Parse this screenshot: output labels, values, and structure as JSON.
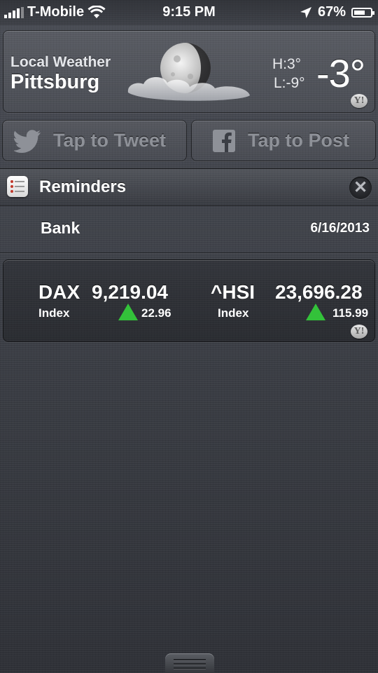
{
  "status_bar": {
    "carrier": "T-Mobile",
    "time": "9:15 PM",
    "battery_percent_label": "67%",
    "battery_level": 0.67,
    "icons": [
      "signal-bars-icon",
      "wifi-icon",
      "location-arrow-icon",
      "battery-icon"
    ]
  },
  "weather": {
    "label": "Local Weather",
    "city": "Pittsburg",
    "high": "H:3°",
    "low": "L:-9°",
    "temperature": "-3°",
    "condition_icon": "moon-cloud-icon",
    "provider_badge": "Y!"
  },
  "share": {
    "tweet_label": "Tap to Tweet",
    "post_label": "Tap to Post",
    "tweet_icon": "twitter-bird-icon",
    "post_icon": "facebook-f-icon"
  },
  "reminders": {
    "title": "Reminders",
    "items": [
      {
        "name": "Bank",
        "date": "6/16/2013"
      }
    ]
  },
  "stocks": {
    "items": [
      {
        "symbol": "DAX",
        "price": "9,219.04",
        "kind": "Index",
        "change": "22.96",
        "direction": "up"
      },
      {
        "symbol": "^HSI",
        "price": "23,696.28",
        "kind": "Index",
        "change": "115.99",
        "direction": "up"
      }
    ],
    "provider_badge": "Y!",
    "up_color": "#33c23a"
  }
}
